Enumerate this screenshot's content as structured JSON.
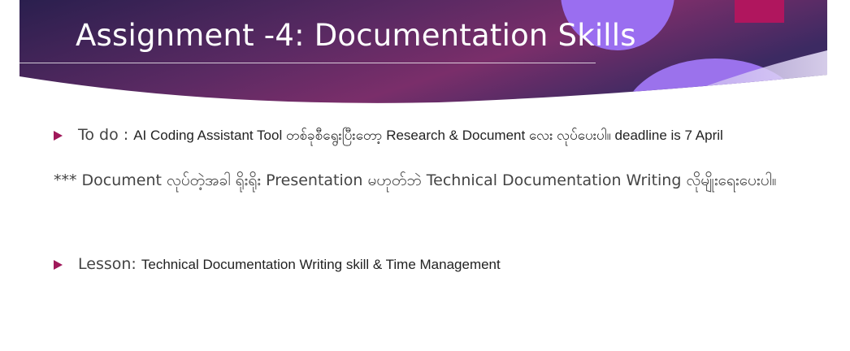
{
  "slide": {
    "title": "Assignment -4: Documentation Skills",
    "colors": {
      "banner_dark": "#2a1f4e",
      "banner_magenta": "#7a2e6a",
      "accent_circle": "#9a6ef0",
      "accent_square": "#b0165e",
      "bullet": "#a0185a"
    }
  },
  "bullets": [
    {
      "lead": "To do : ",
      "text": " AI Coding Assistant Tool တစ်ခုစီရွေးပြီးတော့ Research & Document လေး လုပ်ပေးပါ။ deadline is 7 April"
    },
    {
      "lead": "Lesson: ",
      "text": "Technical Documentation Writing skill & Time Management"
    }
  ],
  "note": "*** Document လုပ်တဲ့အခါ ရိုးရိုး Presentation မဟုတ်ဘဲ  Technical Documentation Writing လိုမျိုးရေးပေးပါ။"
}
